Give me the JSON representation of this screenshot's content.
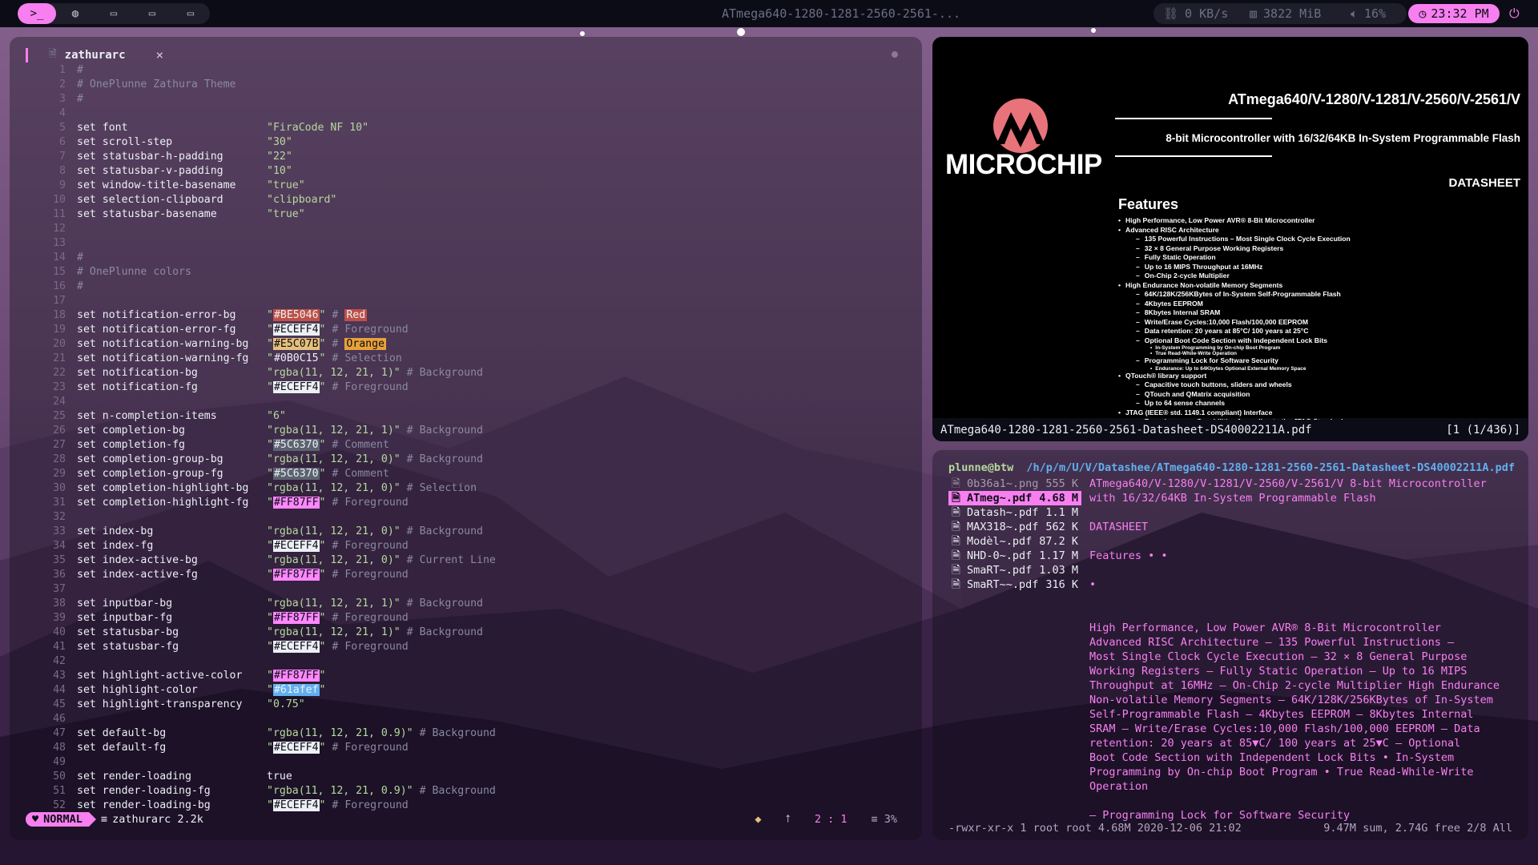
{
  "topbar": {
    "workspaces": [
      {
        "icon": "terminal-icon",
        "glyph": ">_",
        "active": true
      },
      {
        "icon": "globe-icon",
        "glyph": "◍",
        "active": false
      },
      {
        "icon": "monitor-icon",
        "glyph": "▭",
        "active": false
      },
      {
        "icon": "monitor-icon",
        "glyph": "▭",
        "active": false
      },
      {
        "icon": "monitor-icon",
        "glyph": "▭",
        "active": false
      }
    ],
    "window_title": "ATmega640-1280-1281-2560-2561-...",
    "network": "0 KB/s",
    "memory": "3822 MiB",
    "volume": "16%",
    "clock": "23:32 PM",
    "accent": "#F87FF0",
    "bar_bg": "#0b0c15"
  },
  "editor": {
    "tab_name": "zathurarc",
    "tab_close": "×",
    "lines": [
      {
        "n": "1",
        "k": "#",
        "v": "",
        "c": "",
        "kind": "cmt"
      },
      {
        "n": "2",
        "k": "# OnePlunne Zathura Theme",
        "v": "",
        "c": "",
        "kind": "cmt"
      },
      {
        "n": "3",
        "k": "#",
        "v": "",
        "c": "",
        "kind": "cmt"
      },
      {
        "n": "4",
        "k": "",
        "v": "",
        "c": "",
        "kind": "blank"
      },
      {
        "n": "5",
        "k": "set font",
        "v": "\"FiraCode NF 10\"",
        "c": "",
        "kind": "set"
      },
      {
        "n": "6",
        "k": "set scroll-step",
        "v": "\"30\"",
        "c": "",
        "kind": "set"
      },
      {
        "n": "7",
        "k": "set statusbar-h-padding",
        "v": "\"22\"",
        "c": "",
        "kind": "set"
      },
      {
        "n": "8",
        "k": "set statusbar-v-padding",
        "v": "\"10\"",
        "c": "",
        "kind": "set"
      },
      {
        "n": "9",
        "k": "set window-title-basename",
        "v": "\"true\"",
        "c": "",
        "kind": "set"
      },
      {
        "n": "10",
        "k": "set selection-clipboard",
        "v": "\"clipboard\"",
        "c": "",
        "kind": "set"
      },
      {
        "n": "11",
        "k": "set statusbar-basename",
        "v": "\"true\"",
        "c": "",
        "kind": "set"
      },
      {
        "n": "12",
        "k": "",
        "v": "",
        "c": "",
        "kind": "blank"
      },
      {
        "n": "13",
        "k": "",
        "v": "",
        "c": "",
        "kind": "blank"
      },
      {
        "n": "14",
        "k": "#",
        "v": "",
        "c": "",
        "kind": "cmt"
      },
      {
        "n": "15",
        "k": "# OnePlunne colors",
        "v": "",
        "c": "",
        "kind": "cmt"
      },
      {
        "n": "16",
        "k": "#",
        "v": "",
        "c": "",
        "kind": "cmt"
      },
      {
        "n": "17",
        "k": "",
        "v": "",
        "c": "",
        "kind": "blank"
      },
      {
        "n": "18",
        "k": "set notification-error-bg",
        "v": "#BE5046",
        "c": "Red",
        "kind": "swatch",
        "color": "#BE5046",
        "cswatch": "#BE5046"
      },
      {
        "n": "19",
        "k": "set notification-error-fg",
        "v": "#ECEFF4",
        "c": "Foreground",
        "kind": "swatch",
        "color": "#ECEFF4"
      },
      {
        "n": "20",
        "k": "set notification-warning-bg",
        "v": "#E5C07B",
        "c": "Orange",
        "kind": "swatch",
        "color": "#E5C07B",
        "cswatch": "#E8A23A"
      },
      {
        "n": "21",
        "k": "set notification-warning-fg",
        "v": "#0B0C15",
        "c": "Selection",
        "kind": "swatch-plain",
        "color": "#0B0C15"
      },
      {
        "n": "22",
        "k": "set notification-bg",
        "v": "\"rgba(11, 12, 21, 1)\"",
        "c": "Background",
        "kind": "set"
      },
      {
        "n": "23",
        "k": "set notification-fg",
        "v": "#ECEFF4",
        "c": "Foreground",
        "kind": "swatch",
        "color": "#ECEFF4"
      },
      {
        "n": "24",
        "k": "",
        "v": "",
        "c": "",
        "kind": "blank"
      },
      {
        "n": "25",
        "k": "set n-completion-items",
        "v": "\"6\"",
        "c": "",
        "kind": "set"
      },
      {
        "n": "26",
        "k": "set completion-bg",
        "v": "\"rgba(11, 12, 21, 1)\"",
        "c": "Background",
        "kind": "set"
      },
      {
        "n": "27",
        "k": "set completion-fg",
        "v": "#5C6370",
        "c": "Comment",
        "kind": "swatch",
        "color": "#5C6370"
      },
      {
        "n": "28",
        "k": "set completion-group-bg",
        "v": "\"rgba(11, 12, 21, 0)\"",
        "c": "Background",
        "kind": "set"
      },
      {
        "n": "29",
        "k": "set completion-group-fg",
        "v": "#5C6370",
        "c": "Comment",
        "kind": "swatch",
        "color": "#5C6370"
      },
      {
        "n": "30",
        "k": "set completion-highlight-bg",
        "v": "\"rgba(11, 12, 21, 0)\"",
        "c": "Selection",
        "kind": "set"
      },
      {
        "n": "31",
        "k": "set completion-highlight-fg",
        "v": "#FF87FF",
        "c": "Foreground",
        "kind": "swatch",
        "color": "#FF87FF"
      },
      {
        "n": "32",
        "k": "",
        "v": "",
        "c": "",
        "kind": "blank"
      },
      {
        "n": "33",
        "k": "set index-bg",
        "v": "\"rgba(11, 12, 21, 0)\"",
        "c": "Background",
        "kind": "set"
      },
      {
        "n": "34",
        "k": "set index-fg",
        "v": "#ECEFF4",
        "c": "Foreground",
        "kind": "swatch",
        "color": "#ECEFF4"
      },
      {
        "n": "35",
        "k": "set index-active-bg",
        "v": "\"rgba(11, 12, 21, 0)\"",
        "c": "Current Line",
        "kind": "set"
      },
      {
        "n": "36",
        "k": "set index-active-fg",
        "v": "#FF87FF",
        "c": "Foreground",
        "kind": "swatch",
        "color": "#FF87FF"
      },
      {
        "n": "37",
        "k": "",
        "v": "",
        "c": "",
        "kind": "blank"
      },
      {
        "n": "38",
        "k": "set inputbar-bg",
        "v": "\"rgba(11, 12, 21, 1)\"",
        "c": "Background",
        "kind": "set"
      },
      {
        "n": "39",
        "k": "set inputbar-fg",
        "v": "#FF87FF",
        "c": "Foreground",
        "kind": "swatch",
        "color": "#FF87FF"
      },
      {
        "n": "40",
        "k": "set statusbar-bg",
        "v": "\"rgba(11, 12, 21, 1)\"",
        "c": "Background",
        "kind": "set"
      },
      {
        "n": "41",
        "k": "set statusbar-fg",
        "v": "#ECEFF4",
        "c": "Foreground",
        "kind": "swatch",
        "color": "#ECEFF4"
      },
      {
        "n": "42",
        "k": "",
        "v": "",
        "c": "",
        "kind": "blank"
      },
      {
        "n": "43",
        "k": "set highlight-active-color",
        "v": "#FF87FF",
        "c": "",
        "kind": "swatch",
        "color": "#FF87FF"
      },
      {
        "n": "44",
        "k": "set highlight-color",
        "v": "#61afef",
        "c": "",
        "kind": "swatch",
        "color": "#61afef"
      },
      {
        "n": "45",
        "k": "set highlight-transparency",
        "v": "\"0.75\"",
        "c": "",
        "kind": "set"
      },
      {
        "n": "46",
        "k": "",
        "v": "",
        "c": "",
        "kind": "blank"
      },
      {
        "n": "47",
        "k": "set default-bg",
        "v": "\"rgba(11, 12, 21, 0.9)\"",
        "c": "Background",
        "kind": "set"
      },
      {
        "n": "48",
        "k": "set default-fg",
        "v": "#ECEFF4",
        "c": "Foreground",
        "kind": "swatch",
        "color": "#ECEFF4"
      },
      {
        "n": "49",
        "k": "",
        "v": "",
        "c": "",
        "kind": "blank"
      },
      {
        "n": "50",
        "k": "set render-loading",
        "v": "true",
        "c": "",
        "kind": "plain"
      },
      {
        "n": "51",
        "k": "set render-loading-fg",
        "v": "\"rgba(11, 12, 21, 0.9)\"",
        "c": "Background",
        "kind": "set"
      },
      {
        "n": "52",
        "k": "set render-loading-bg",
        "v": "#ECEFF4",
        "c": "Foreground",
        "kind": "swatch",
        "color": "#ECEFF4"
      }
    ],
    "status": {
      "mode": "NORMAL",
      "file": "zathurarc 2.2k",
      "position": "2 : 1",
      "percent": "≡ 3%"
    }
  },
  "pdf": {
    "title": "ATmega640/V-1280/V-1281/V-2560/V-2561/V",
    "subtitle": "8-bit Microcontroller with 16/32/64KB In-System Programmable Flash",
    "datasheet": "DATASHEET",
    "logo": "MICROCHIP",
    "features_heading": "Features",
    "features": [
      {
        "level": 1,
        "text": "High Performance, Low Power AVR® 8-Bit Microcontroller"
      },
      {
        "level": 1,
        "text": "Advanced RISC Architecture"
      },
      {
        "level": 2,
        "text": "135 Powerful Instructions – Most Single Clock Cycle Execution"
      },
      {
        "level": 2,
        "text": "32 × 8 General Purpose Working Registers"
      },
      {
        "level": 2,
        "text": "Fully Static Operation"
      },
      {
        "level": 2,
        "text": "Up to 16 MIPS Throughput at 16MHz"
      },
      {
        "level": 2,
        "text": "On-Chip 2-cycle Multiplier"
      },
      {
        "level": 1,
        "text": "High Endurance Non-volatile Memory Segments"
      },
      {
        "level": 2,
        "text": "64K/128K/256KBytes of In-System Self-Programmable Flash"
      },
      {
        "level": 2,
        "text": "4Kbytes EEPROM"
      },
      {
        "level": 2,
        "text": "8Kbytes Internal SRAM"
      },
      {
        "level": 2,
        "text": "Write/Erase Cycles:10,000 Flash/100,000 EEPROM"
      },
      {
        "level": 2,
        "text": "Data retention: 20 years at 85°C/ 100 years at 25°C"
      },
      {
        "level": 2,
        "text": "Optional Boot Code Section with Independent Lock Bits"
      },
      {
        "level": 3,
        "text": "In-System Programming by On-chip Boot Program"
      },
      {
        "level": 3,
        "text": "True Read-While-Write Operation"
      },
      {
        "level": 2,
        "text": "Programming Lock for Software Security"
      },
      {
        "level": 3,
        "text": "Endurance: Up to 64Kbytes Optional External Memory Space"
      },
      {
        "level": 1,
        "text": "QTouch® library support"
      },
      {
        "level": 2,
        "text": "Capacitive touch buttons, sliders and wheels"
      },
      {
        "level": 2,
        "text": "QTouch and QMatrix acquisition"
      },
      {
        "level": 2,
        "text": "Up to 64 sense channels"
      },
      {
        "level": 1,
        "text": "JTAG (IEEE® std. 1149.1 compliant) Interface"
      },
      {
        "level": 2,
        "text": "Boundary-scan Capabilities According to the JTAG Standard"
      }
    ],
    "status_file": "ATmega640-1280-1281-2560-2561-Datasheet-DS40002211A.pdf",
    "status_page": "[1 (1/436)]"
  },
  "ranger": {
    "user": "plunne@btw",
    "path_dim": "/h/p/m/U/V/Datashee/",
    "path_file": "ATmega640-1280-1281-2560-2561-Datasheet-DS40002211A.pdf",
    "files": [
      {
        "name": "0b36a1~.png",
        "size": "555 K",
        "state": "dim"
      },
      {
        "name": "ATmeg~.pdf",
        "size": "4.68 M",
        "state": "sel"
      },
      {
        "name": "Datash~.pdf",
        "size": "1.1 M",
        "state": ""
      },
      {
        "name": "MAX318~.pdf",
        "size": "562 K",
        "state": ""
      },
      {
        "name": "Modèl~.pdf",
        "size": "87.2 K",
        "state": ""
      },
      {
        "name": "NHD-0~.pdf",
        "size": "1.17 M",
        "state": ""
      },
      {
        "name": "SmaRT~.pdf",
        "size": "1.03 M",
        "state": ""
      },
      {
        "name": "SmaRT~~.pdf",
        "size": "316 K",
        "state": ""
      }
    ],
    "preview": [
      "ATmega640/V-1280/V-1281/V-2560/V-2561/V 8-bit Microcontroller",
      "with 16/32/64KB In-System Programmable Flash",
      "",
      "DATASHEET",
      "",
      "Features • •",
      "",
      "•",
      "",
      "",
      "High Performance, Low Power AVR® 8-Bit Microcontroller",
      "Advanced RISC Architecture – 135 Powerful Instructions –",
      "Most Single Clock Cycle Execution – 32 × 8 General Purpose",
      "Working Registers – Fully Static Operation – Up to 16 MIPS",
      "Throughput at 16MHz – On-Chip 2-cycle Multiplier High Endurance",
      "Non-volatile Memory Segments – 64K/128K/256KBytes of In-System",
      "Self-Programmable Flash – 4Kbytes EEPROM – 8Kbytes Internal",
      "SRAM – Write/Erase Cycles:10,000 Flash/100,000 EEPROM – Data",
      "retention: 20 years at 85▼C/ 100 years at 25▼C – Optional",
      "Boot Code Section with Independent Lock Bits • In-System",
      "Programming by On-chip Boot Program • True Read-While-Write",
      "Operation",
      "",
      "– Programming Lock for Software Security"
    ],
    "bottom_left": "-rwxr-xr-x 1 root root 4.68M 2020-12-06 21:02",
    "bottom_right": "9.47M sum, 2.74G free  2/8  All"
  }
}
